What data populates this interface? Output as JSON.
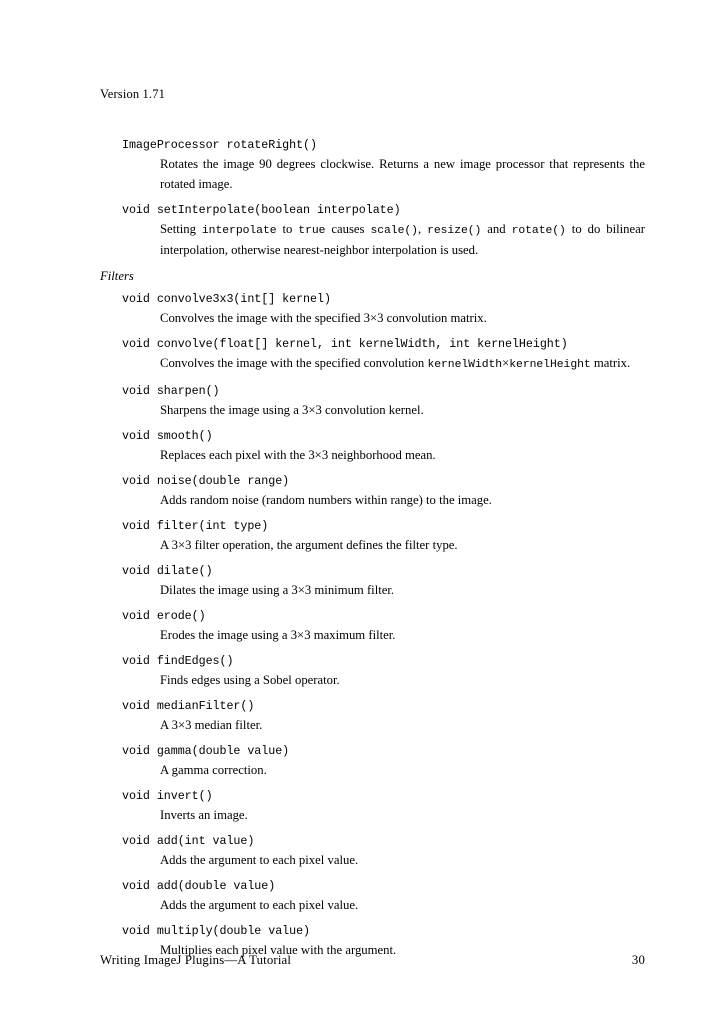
{
  "header": {
    "version_line": "Version 1.71"
  },
  "footer": {
    "title": "Writing ImageJ Plugins—A Tutorial",
    "page_number": "30"
  },
  "sections": [
    {
      "heading": null,
      "entries": [
        {
          "signature": "ImageProcessor rotateRight()",
          "description_parts": [
            {
              "type": "text",
              "text": "Rotates the image 90 degrees clockwise. Returns a new image processor that repre­sents the rotated image."
            }
          ],
          "description_plain": "Rotates the image 90 degrees clockwise. Returns a new image processor that represents the rotated image."
        },
        {
          "signature": "void setInterpolate(boolean interpolate)",
          "description_parts": [
            {
              "type": "text",
              "text": "Setting "
            },
            {
              "type": "code",
              "text": "interpolate"
            },
            {
              "type": "text",
              "text": " to "
            },
            {
              "type": "code",
              "text": "true"
            },
            {
              "type": "text",
              "text": " causes "
            },
            {
              "type": "code",
              "text": "scale()"
            },
            {
              "type": "text",
              "text": ", "
            },
            {
              "type": "code",
              "text": "resize()"
            },
            {
              "type": "text",
              "text": " and "
            },
            {
              "type": "code",
              "text": "rotate()"
            },
            {
              "type": "text",
              "text": " to do bilinear interpolation, otherwise nearest-neighbor interpolation is used."
            }
          ],
          "description_plain": "Setting interpolate to true causes scale(), resize() and rotate() to do bilinear interpolation, otherwise nearest-neighbor interpolation is used."
        }
      ]
    },
    {
      "heading": "Filters",
      "entries": [
        {
          "signature": "void convolve3x3(int[] kernel)",
          "description_parts": [
            {
              "type": "text",
              "text": "Convolves the image with the specified 3×3 convolution matrix."
            }
          ],
          "description_plain": "Convolves the image with the specified 3×3 convolution matrix."
        },
        {
          "signature": "void convolve(float[] kernel, int kernelWidth, int kernelHeight)",
          "description_parts": [
            {
              "type": "text",
              "text": "Convolves the image with the specified convolution "
            },
            {
              "type": "code",
              "text": "kernelWidth"
            },
            {
              "type": "text",
              "text": "×"
            },
            {
              "type": "code",
              "text": "kernelHeight"
            },
            {
              "type": "text",
              "text": " matrix."
            }
          ],
          "description_plain": "Convolves the image with the specified convolution kernelWidth×kernelHeight matrix."
        },
        {
          "signature": "void sharpen()",
          "description_parts": [
            {
              "type": "text",
              "text": "Sharpens the image using a 3×3 convolution kernel."
            }
          ],
          "description_plain": "Sharpens the image using a 3×3 convolution kernel."
        },
        {
          "signature": "void smooth()",
          "description_parts": [
            {
              "type": "text",
              "text": "Replaces each pixel with the 3×3 neighborhood mean."
            }
          ],
          "description_plain": "Replaces each pixel with the 3×3 neighborhood mean."
        },
        {
          "signature": "void noise(double range)",
          "description_parts": [
            {
              "type": "text",
              "text": "Adds random noise (random numbers within range) to the image."
            }
          ],
          "description_plain": "Adds random noise (random numbers within range) to the image."
        },
        {
          "signature": "void filter(int type)",
          "description_parts": [
            {
              "type": "text",
              "text": "A 3×3 filter operation, the argument defines the filter type."
            }
          ],
          "description_plain": "A 3×3 filter operation, the argument defines the filter type."
        },
        {
          "signature": "void dilate()",
          "description_parts": [
            {
              "type": "text",
              "text": "Dilates the image using a 3×3 minimum filter."
            }
          ],
          "description_plain": "Dilates the image using a 3×3 minimum filter."
        },
        {
          "signature": "void erode()",
          "description_parts": [
            {
              "type": "text",
              "text": "Erodes the image using a 3×3 maximum filter."
            }
          ],
          "description_plain": "Erodes the image using a 3×3 maximum filter."
        },
        {
          "signature": "void findEdges()",
          "description_parts": [
            {
              "type": "text",
              "text": "Finds edges using a Sobel operator."
            }
          ],
          "description_plain": "Finds edges using a Sobel operator."
        },
        {
          "signature": "void medianFilter()",
          "description_parts": [
            {
              "type": "text",
              "text": "A 3×3 median filter."
            }
          ],
          "description_plain": "A 3×3 median filter."
        },
        {
          "signature": "void gamma(double value)",
          "description_parts": [
            {
              "type": "text",
              "text": "A gamma correction."
            }
          ],
          "description_plain": "A gamma correction."
        },
        {
          "signature": "void invert()",
          "description_parts": [
            {
              "type": "text",
              "text": "Inverts an image."
            }
          ],
          "description_plain": "Inverts an image."
        },
        {
          "signature": "void add(int value)",
          "description_parts": [
            {
              "type": "text",
              "text": "Adds the argument to each pixel value."
            }
          ],
          "description_plain": "Adds the argument to each pixel value."
        },
        {
          "signature": "void add(double value)",
          "description_parts": [
            {
              "type": "text",
              "text": "Adds the argument to each pixel value."
            }
          ],
          "description_plain": "Adds the argument to each pixel value."
        },
        {
          "signature": "void multiply(double value)",
          "description_parts": [
            {
              "type": "text",
              "text": "Multiplies each pixel value with the argument."
            }
          ],
          "description_plain": "Multiplies each pixel value with the argument."
        }
      ]
    }
  ]
}
